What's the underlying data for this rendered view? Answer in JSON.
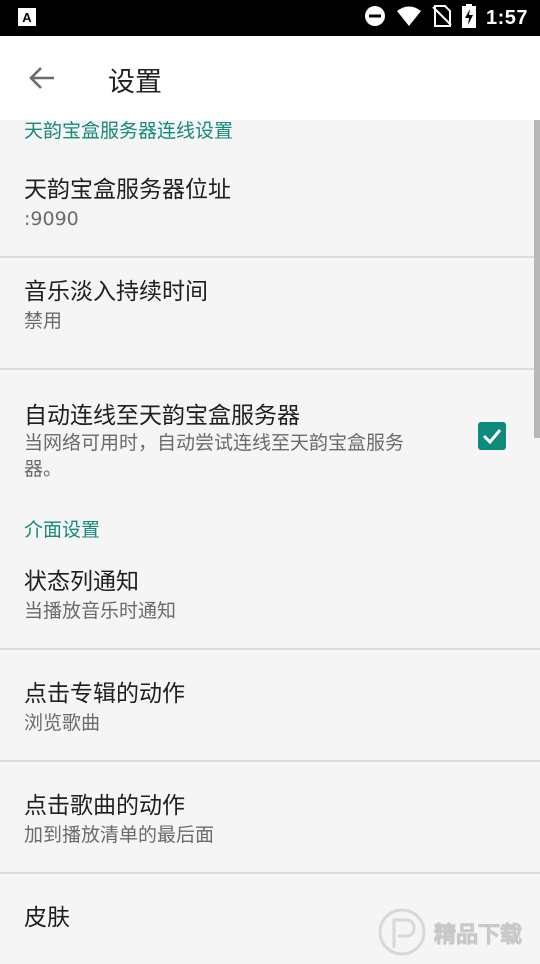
{
  "status_bar": {
    "time": "1:57",
    "icons": [
      "app-notification-icon",
      "do-not-disturb-icon",
      "wifi-icon",
      "no-sim-icon",
      "battery-charging-icon"
    ]
  },
  "app_bar": {
    "title": "设置",
    "back_icon": "arrow-back-icon"
  },
  "sections": {
    "server": {
      "header": "天韵宝盒服务器连线设置",
      "address": {
        "title": "天韵宝盒服务器位址",
        "summary": ":9090"
      },
      "fade": {
        "title": "音乐淡入持续时间",
        "summary": "禁用"
      },
      "autoconnect": {
        "title": "自动连线至天韵宝盒服务器",
        "summary_line1": "当网络可用时，自动尝试连线至天韵宝盒服务",
        "summary_line2": "器。",
        "checked": true
      }
    },
    "ui": {
      "header": "介面设置",
      "notification": {
        "title": "状态列通知",
        "summary": "当播放音乐时通知"
      },
      "album_click": {
        "title": "点击专辑的动作",
        "summary": "浏览歌曲"
      },
      "song_click": {
        "title": "点击歌曲的动作",
        "summary": "加到播放清单的最后面"
      },
      "skin": {
        "title": "皮肤"
      }
    }
  },
  "colors": {
    "accent": "#16897a",
    "background": "#f5f5f5",
    "divider": "#dcdcdc"
  },
  "watermark": {
    "text": "精品下载"
  }
}
